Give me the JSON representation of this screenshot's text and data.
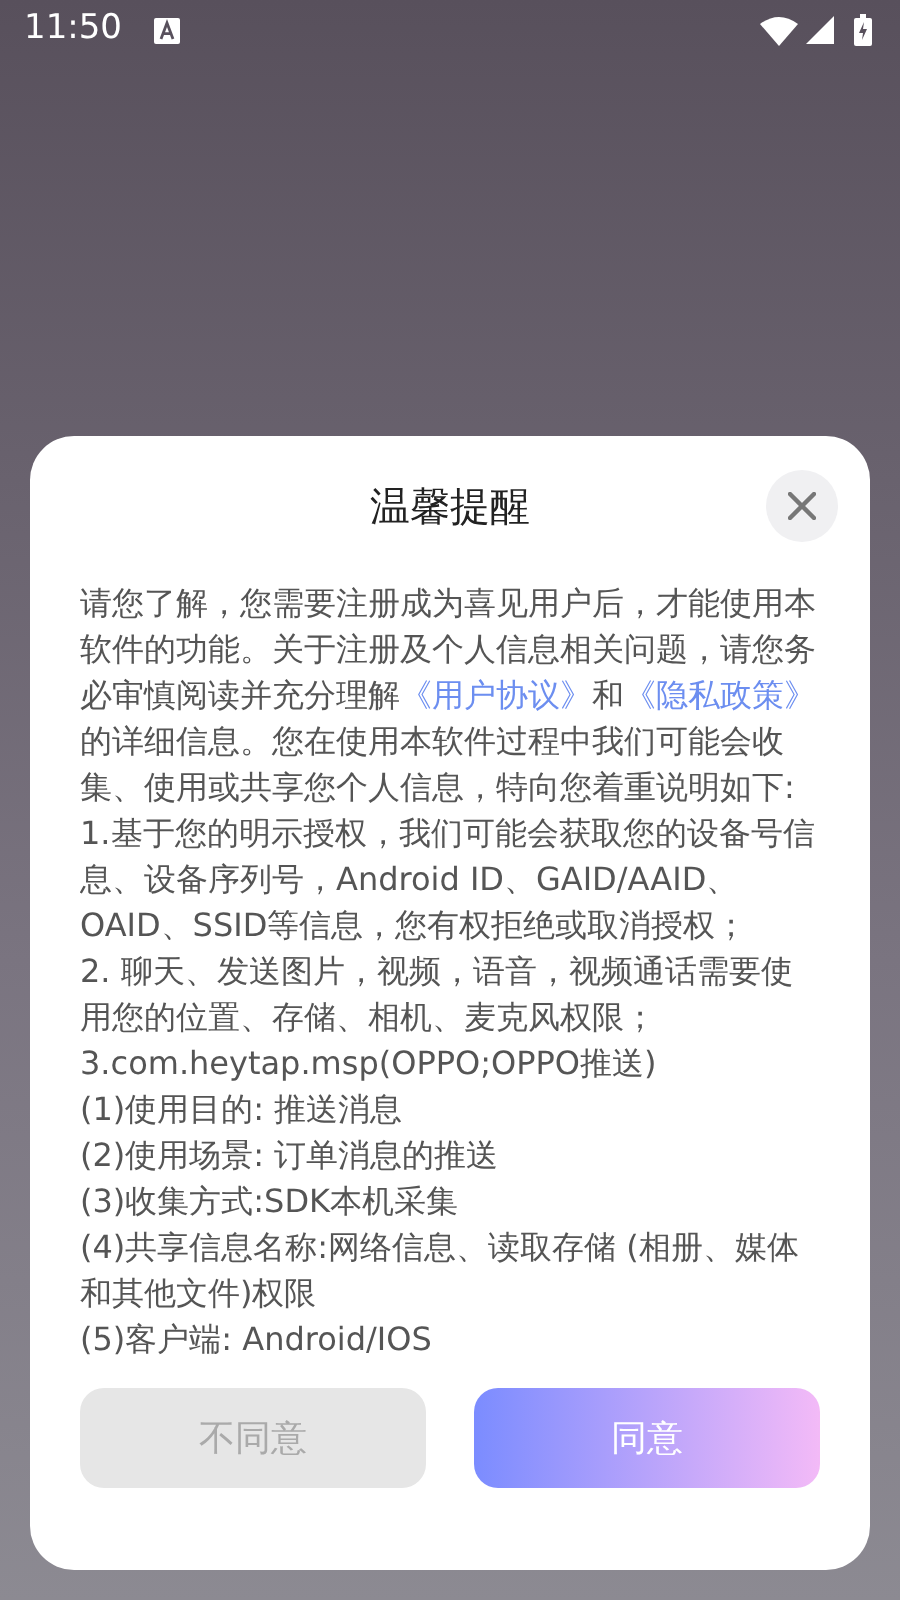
{
  "status_bar": {
    "time": "11:50"
  },
  "dialog": {
    "title": "温馨提醒",
    "intro": [
      {
        "kind": "text",
        "text": "请您了解，您需要注册成为喜见用户后，才能使用本软件的功能。关于注册及个人信息相关问题，请您务必审慎阅读并充分理解"
      },
      {
        "kind": "link",
        "text": "《用户协议》"
      },
      {
        "kind": "text",
        "text": "和"
      },
      {
        "kind": "link",
        "text": "《隐私政策》"
      },
      {
        "kind": "text",
        "text": "的详细信息。您在使用本软件过程中我们可能会收集、使用或共享您个人信息，特向您着重说明如下:"
      }
    ],
    "items": [
      "1.基于您的明示授权，我们可能会获取您的设备号信息、设备序列号，Android ID、GAID/AAID、OAID、SSID等信息，您有权拒绝或取消授权；",
      "2. 聊天、发送图片，视频，语音，视频通话需要使用您的位置、存储、相机、麦克风权限；",
      "3.com.heytap.msp(OPPO;OPPO推送)",
      "(1)使用目的: 推送消息",
      "(2)使用场景: 订单消息的推送",
      "(3)收集方式:SDK本机采集",
      "(4)共享信息名称:网络信息、读取存储 (相册、媒体和其他文件)权限",
      "(5)客户端: Android/IOS"
    ],
    "buttons": [
      {
        "kind": "secondary",
        "label": "不同意"
      },
      {
        "kind": "primary",
        "label": "同意"
      }
    ]
  }
}
